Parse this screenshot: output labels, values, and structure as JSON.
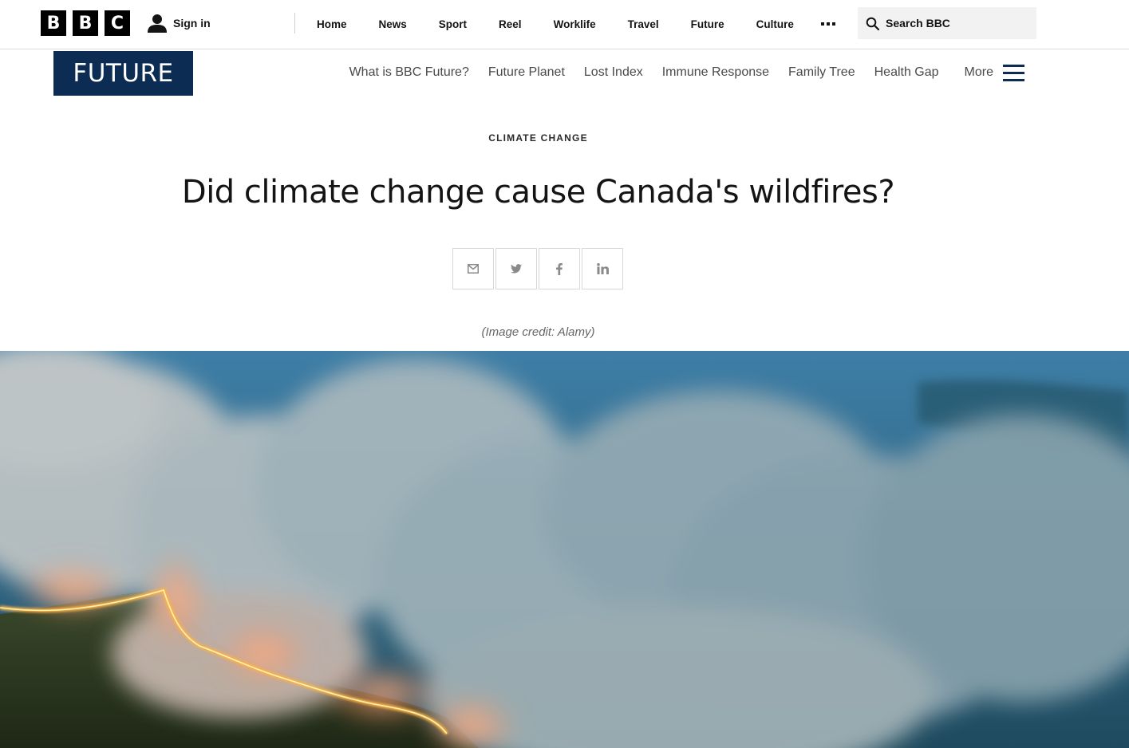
{
  "top_bar": {
    "logo_letters": [
      "B",
      "B",
      "C"
    ],
    "sign_in_label": "Sign in",
    "nav_items": [
      "Home",
      "News",
      "Sport",
      "Reel",
      "Worklife",
      "Travel",
      "Future",
      "Culture"
    ],
    "more_icon": "more-dots-icon",
    "search_placeholder": "Search BBC"
  },
  "section": {
    "logo_text": "FUTURE",
    "nav_items": [
      "What is BBC Future?",
      "Future Planet",
      "Lost Index",
      "Immune Response",
      "Family Tree",
      "Health Gap"
    ],
    "more_label": "More"
  },
  "article": {
    "category": "CLIMATE CHANGE",
    "headline": "Did climate change cause Canada's wildfires?",
    "share_icons": [
      "email-icon",
      "twitter-icon",
      "facebook-icon",
      "linkedin-icon"
    ],
    "image_credit": "(Image credit: Alamy)"
  },
  "colors": {
    "future_brand": "#0c2c53",
    "bbc_block": "#000000",
    "text": "#141414"
  }
}
